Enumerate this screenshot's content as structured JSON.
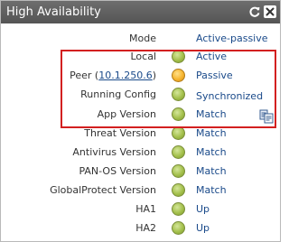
{
  "window": {
    "title": "High Availability",
    "refresh_icon": "refresh-icon",
    "close_icon": "close-icon"
  },
  "rows": [
    {
      "label": "Mode",
      "value": "Active-passive",
      "led": null
    },
    {
      "label": "Local",
      "value": "Active",
      "led": "green"
    },
    {
      "label_prefix": "Peer (",
      "label_link": "10.1.250.6",
      "label_suffix": ")",
      "value": "Passive",
      "led": "orange"
    },
    {
      "label": "Running Config",
      "value": "Synchronized",
      "led": "green"
    },
    {
      "label": "App Version",
      "value": "Match",
      "led": "green"
    },
    {
      "label": "Threat Version",
      "value": "Match",
      "led": "green"
    },
    {
      "label": "Antivirus Version",
      "value": "Match",
      "led": "green"
    },
    {
      "label": "PAN-OS Version",
      "value": "Match",
      "led": "green"
    },
    {
      "label": "GlobalProtect Version",
      "value": "Match",
      "led": "green"
    },
    {
      "label": "HA1",
      "value": "Up",
      "led": "green"
    },
    {
      "label": "HA2",
      "value": "Up",
      "led": "green"
    }
  ],
  "sync_icon": "config-sync-icon",
  "colors": {
    "titlebar": "#5e5e5e",
    "value_text": "#1a4a8a",
    "led_green": "#a4c04c",
    "led_orange": "#f6b530",
    "highlight_border": "#d32020"
  }
}
